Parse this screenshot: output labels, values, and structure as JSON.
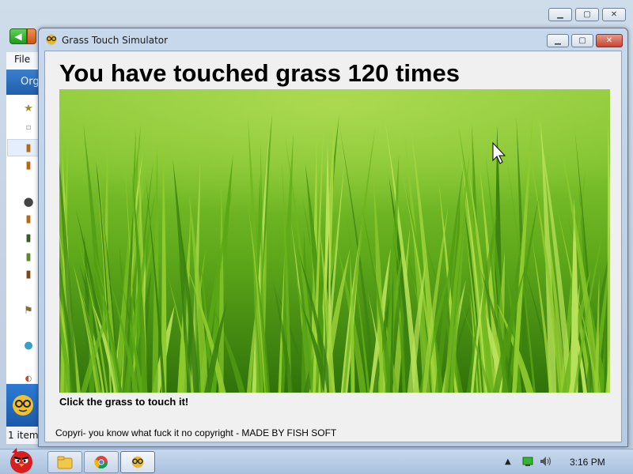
{
  "background_window": {
    "menu_file_label": "File",
    "organize_label": "Org",
    "status_text": "1 item"
  },
  "app": {
    "title": "Grass Touch Simulator",
    "heading_prefix": "You have touched grass",
    "touch_count": "120",
    "heading_suffix": "times",
    "hint": "Click the grass to touch it!",
    "copyright": "Copyri- you know what fuck it no copyright - MADE BY FISH SOFT"
  },
  "taskbar": {
    "clock": "3:16 PM",
    "tray_icons": [
      "show-hidden-icons-icon",
      "network-icon",
      "volume-icon"
    ]
  },
  "colors": {
    "grass_light": "#86c535",
    "grass_dark": "#347a0b",
    "taskbar": "#b9cde6",
    "close_button": "#c54632"
  }
}
